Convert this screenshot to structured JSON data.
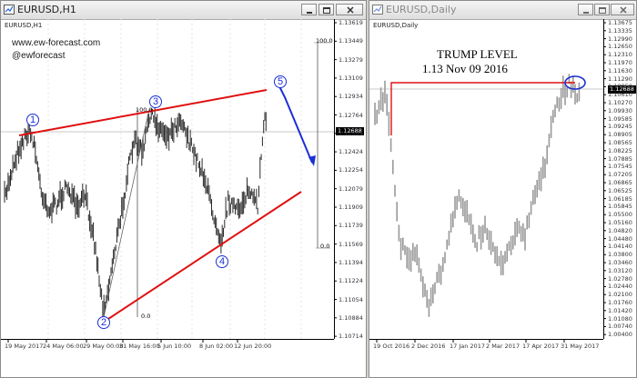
{
  "left_window": {
    "title": "EURUSD,H1",
    "symbol_label": "EURUSD,H1",
    "watermark_url": "www.ew-forecast.com",
    "watermark_handle": "@ewforecast",
    "current_price": "1.12688",
    "y_ticks": [
      "1.13619",
      "1.13449",
      "1.13279",
      "1.13109",
      "1.12934",
      "1.12764",
      "1.12594",
      "1.12424",
      "1.12254",
      "1.12079",
      "1.11909",
      "1.11739",
      "1.11569",
      "1.11394",
      "1.11224",
      "1.11054",
      "1.10884",
      "1.10714"
    ],
    "x_ticks": [
      "19 May 2017",
      "24 May 06:00",
      "29 May 00:00",
      "31 May 16:00",
      "5 Jun 10:00",
      "8 Jun 02:00",
      "12 Jun 20:00"
    ],
    "fib_labels": {
      "top": "100.0",
      "bottom": "0.0",
      "mid_top": "100.0",
      "mid_bottom": "0.0"
    },
    "wave_labels": [
      "1",
      "2",
      "3",
      "4",
      "5"
    ]
  },
  "right_window": {
    "title": "EURUSD,Daily",
    "symbol_label": "EURUSD,Daily",
    "annotation_title": "TRUMP LEVEL",
    "annotation_sub": "1.13  Nov 09 2016",
    "current_price": "1.12688",
    "y_ticks": [
      "1.13675",
      "1.13335",
      "1.12990",
      "1.12650",
      "1.12310",
      "1.11970",
      "1.11630",
      "1.11290",
      "1.10950",
      "1.10610",
      "1.10270",
      "1.09930",
      "1.09585",
      "1.09245",
      "1.08905",
      "1.08565",
      "1.08225",
      "1.07885",
      "1.07545",
      "1.07205",
      "1.06865",
      "1.06525",
      "1.06185",
      "1.05845",
      "1.05500",
      "1.05160",
      "1.04820",
      "1.04480",
      "1.04140",
      "1.03800",
      "1.03460",
      "1.03120",
      "1.02780",
      "1.02440",
      "1.02100",
      "1.01760",
      "1.01420",
      "1.01080",
      "1.00740",
      "1.00400"
    ],
    "x_ticks": [
      "19 Oct 2016",
      "2 Dec 2016",
      "17 Jan 2017",
      "2 Mar 2017",
      "17 Apr 2017",
      "31 May 2017"
    ]
  },
  "colors": {
    "trendline": "#e01010",
    "wave_label": "#1b2fd6",
    "candles_left": "#2a2a2a",
    "candles_right": "#9a9a9a",
    "price_box": "#000000"
  },
  "icons": [
    "chart-window-icon",
    "minimize-icon",
    "restore-icon",
    "close-icon"
  ]
}
